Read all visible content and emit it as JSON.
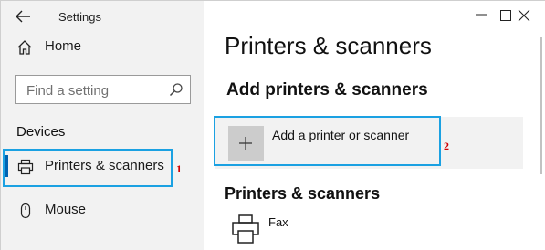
{
  "window": {
    "title": "Settings"
  },
  "sidebar": {
    "home_label": "Home",
    "search": {
      "placeholder": "Find a setting"
    },
    "section": "Devices",
    "items": [
      {
        "label": "Printers & scanners",
        "selected": true,
        "icon": "printer-icon"
      },
      {
        "label": "Mouse",
        "selected": false,
        "icon": "mouse-icon"
      }
    ]
  },
  "main": {
    "title": "Printers & scanners",
    "add_section": {
      "heading": "Add printers & scanners",
      "add_button_label": "Add a printer or scanner",
      "icon": "plus-icon"
    },
    "list_section": {
      "heading": "Printers & scanners",
      "devices": [
        {
          "name": "Fax",
          "icon": "printer-icon"
        }
      ]
    }
  },
  "annotations": {
    "step1": "1",
    "step2": "2"
  },
  "colors": {
    "accent": "#0063b1",
    "highlight": "#1ba1e2",
    "step_number": "#d00000",
    "sidebar_bg": "#f2f2f2"
  }
}
